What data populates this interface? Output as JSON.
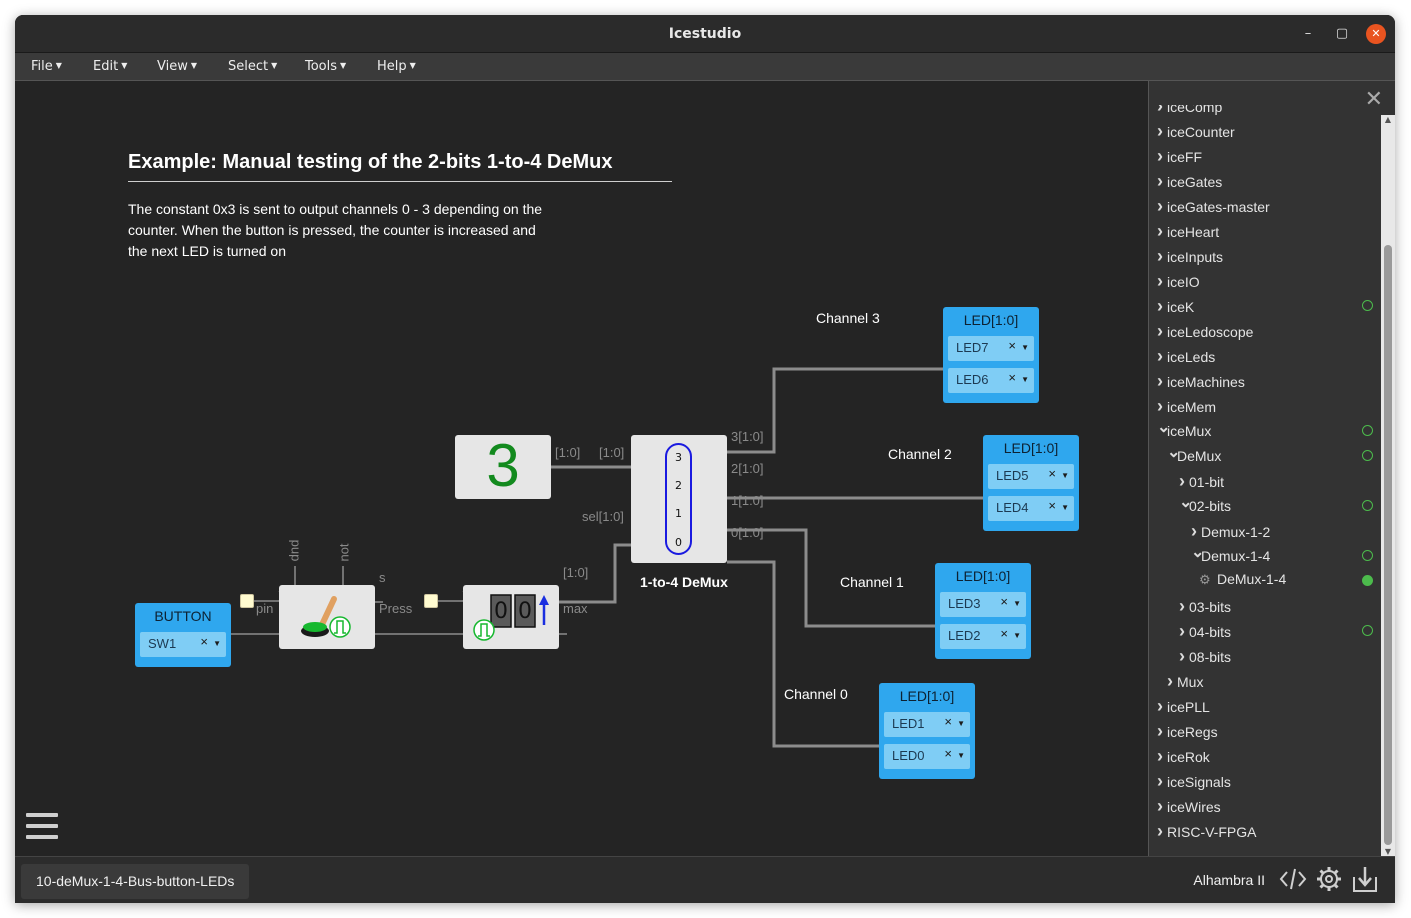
{
  "window": {
    "title": "Icestudio"
  },
  "menubar": [
    {
      "label": "File"
    },
    {
      "label": "Edit"
    },
    {
      "label": "View"
    },
    {
      "label": "Select"
    },
    {
      "label": "Tools"
    },
    {
      "label": "Help"
    }
  ],
  "canvas": {
    "example_title": "Example: Manual testing of the 2-bits 1-to-4 DeMux",
    "example_description": "The constant 0x3 is sent to output channels 0 - 3 depending on the counter. When the button is pressed, the counter is increased and the next LED is turned on",
    "button_block": {
      "title": "BUTTON",
      "pin": "SW1",
      "remove": "×"
    },
    "pull_up_ports": {
      "up": "pup",
      "not": "not",
      "s": "s",
      "pin": "pin",
      "press": "Press"
    },
    "counter_ports": {
      "out": "[1:0]",
      "max": "max"
    },
    "counter_digits": [
      "0",
      "0"
    ],
    "constant": {
      "value": "3",
      "out": "[1:0]"
    },
    "demux": {
      "label": "1-to-4 DeMux",
      "in": "[1:0]",
      "sel": "sel[1:0]",
      "outputs": [
        "3[1:0]",
        "2[1:0]",
        "1[1:0]",
        "0[1:0]"
      ],
      "digits": [
        "3",
        "2",
        "1",
        "0"
      ]
    },
    "channels": [
      {
        "label": "Channel 3",
        "title": "LED[1:0]",
        "pins": [
          "LED7",
          "LED6"
        ]
      },
      {
        "label": "Channel 2",
        "title": "LED[1:0]",
        "pins": [
          "LED5",
          "LED4"
        ]
      },
      {
        "label": "Channel 1",
        "title": "LED[1:0]",
        "pins": [
          "LED3",
          "LED2"
        ]
      },
      {
        "label": "Channel 0",
        "title": "LED[1:0]",
        "pins": [
          "LED1",
          "LED0"
        ]
      }
    ],
    "remove_mark": "×"
  },
  "sidebar": {
    "close": "✕",
    "items": [
      {
        "label": "iceComp",
        "open": false,
        "depth": 0,
        "dot": "none"
      },
      {
        "label": "iceCounter",
        "open": false,
        "depth": 0,
        "dot": "none"
      },
      {
        "label": "iceFF",
        "open": false,
        "depth": 0,
        "dot": "none"
      },
      {
        "label": "iceGates",
        "open": false,
        "depth": 0,
        "dot": "none"
      },
      {
        "label": "iceGates-master",
        "open": false,
        "depth": 0,
        "dot": "none"
      },
      {
        "label": "iceHeart",
        "open": false,
        "depth": 0,
        "dot": "none"
      },
      {
        "label": "iceInputs",
        "open": false,
        "depth": 0,
        "dot": "none"
      },
      {
        "label": "iceIO",
        "open": false,
        "depth": 0,
        "dot": "none"
      },
      {
        "label": "iceK",
        "open": false,
        "depth": 0,
        "dot": "outline"
      },
      {
        "label": "iceLedoscope",
        "open": false,
        "depth": 0,
        "dot": "none"
      },
      {
        "label": "iceLeds",
        "open": false,
        "depth": 0,
        "dot": "none"
      },
      {
        "label": "iceMachines",
        "open": false,
        "depth": 0,
        "dot": "none"
      },
      {
        "label": "iceMem",
        "open": false,
        "depth": 0,
        "dot": "none"
      },
      {
        "label": "iceMux",
        "open": true,
        "depth": 0,
        "dot": "outline"
      },
      {
        "label": "DeMux",
        "open": true,
        "depth": 1,
        "dot": "outline"
      },
      {
        "label": "01-bit",
        "open": false,
        "depth": 2,
        "dot": "none"
      },
      {
        "label": "02-bits",
        "open": true,
        "depth": 2,
        "dot": "outline"
      },
      {
        "label": "Demux-1-2",
        "open": false,
        "depth": 3,
        "dot": "none"
      },
      {
        "label": "Demux-1-4",
        "open": true,
        "depth": 3,
        "dot": "outline"
      },
      {
        "label": "DeMux-1-4",
        "open": false,
        "depth": 4,
        "dot": "filled",
        "leaf": true
      },
      {
        "label": "03-bits",
        "open": false,
        "depth": 2,
        "dot": "none"
      },
      {
        "label": "04-bits",
        "open": false,
        "depth": 2,
        "dot": "outline"
      },
      {
        "label": "08-bits",
        "open": false,
        "depth": 2,
        "dot": "none"
      },
      {
        "label": "Mux",
        "open": false,
        "depth": 1,
        "dot": "none"
      },
      {
        "label": "icePLL",
        "open": false,
        "depth": 0,
        "dot": "none"
      },
      {
        "label": "iceRegs",
        "open": false,
        "depth": 0,
        "dot": "none"
      },
      {
        "label": "iceRok",
        "open": false,
        "depth": 0,
        "dot": "none"
      },
      {
        "label": "iceSignals",
        "open": false,
        "depth": 0,
        "dot": "none"
      },
      {
        "label": "iceWires",
        "open": false,
        "depth": 0,
        "dot": "none"
      },
      {
        "label": "RISC-V-FPGA",
        "open": false,
        "depth": 0,
        "dot": "none"
      }
    ]
  },
  "footer": {
    "file_name": "10-deMux-1-4-Bus-button-LEDs",
    "board": "Alhambra II"
  },
  "colors": {
    "accent_block": "#2fa7ee",
    "pin_row": "#7fcdf5",
    "wire": "#8c8c8c",
    "status_dot": "#4cbb4c",
    "close_button": "#e95420"
  }
}
